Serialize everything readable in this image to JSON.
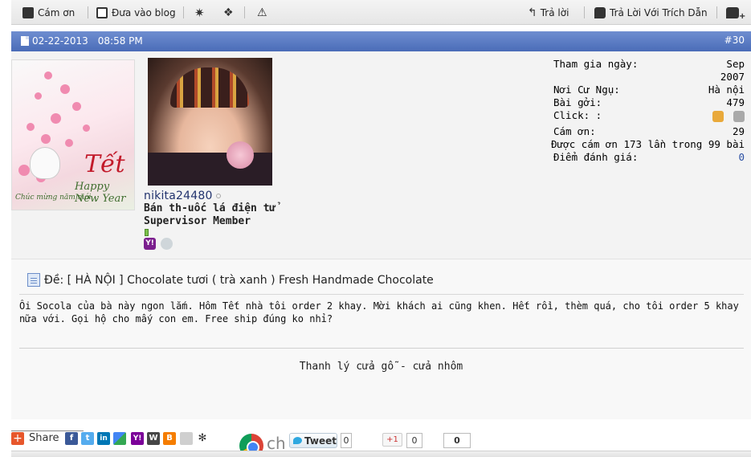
{
  "toolbar": {
    "thanks_label": "Cám ơn",
    "blog_label": "Đưa vào blog",
    "reply_label": "Trả lời",
    "quote_label": "Trả Lời Với Trích Dẫn"
  },
  "post": {
    "date": "02-22-2013",
    "time": "08:58 PM",
    "number": "#30",
    "title": "Đề: [ HÀ NỘI ] Chocolate tươi ( trà xanh ) Fresh Handmade Chocolate",
    "body": "Ôi Socola của bà này ngon lắm. Hôm Tết nhà tôi order 2 khay. Mời khách ai cũng khen. Hết rồi, thèm quá, cho tôi order 5 khay nữa với. Gọi hộ cho mấy con em. Free ship đúng ko nhỉ?",
    "signature": "Thanh lý cửa gỗ - cửa nhôm"
  },
  "user": {
    "name": "nikita24480",
    "title_line1": "Bán th-uốc lá điện tử",
    "title_line2": "Supervisor Member",
    "im_yahoo": "Y!"
  },
  "greeting_card": {
    "word": "Tết",
    "happy": "Happy New Year",
    "caption": "Chúc mừng năm mới"
  },
  "stats": {
    "joined_label": "Tham gia ngày:",
    "joined_value_1": "Sep",
    "joined_value_2": "2007",
    "location_label": "Nơi Cư Ngụ:",
    "location_value": "Hà nội",
    "posts_label": "Bài gởi:",
    "posts_value": "479",
    "click_label": "Click: :",
    "thanks_label": "Cám ơn:",
    "thanks_value": "29",
    "thanked_text": "Được cám ơn 173 lần trong 99 bài",
    "rating_label": "Điểm đánh giá:",
    "rating_value": "0"
  },
  "share": {
    "label": "Share",
    "tweet_label": "Tweet",
    "tweet_count": "0",
    "gplus_label": "+1",
    "gplus_count": "0",
    "fb_count": "0",
    "chrome_text": "ch",
    "plus_glyph": "+"
  },
  "colors": {
    "header_blue": "#4a6cb8",
    "username": "#22336e",
    "rating_value": "#2a4fa3"
  }
}
